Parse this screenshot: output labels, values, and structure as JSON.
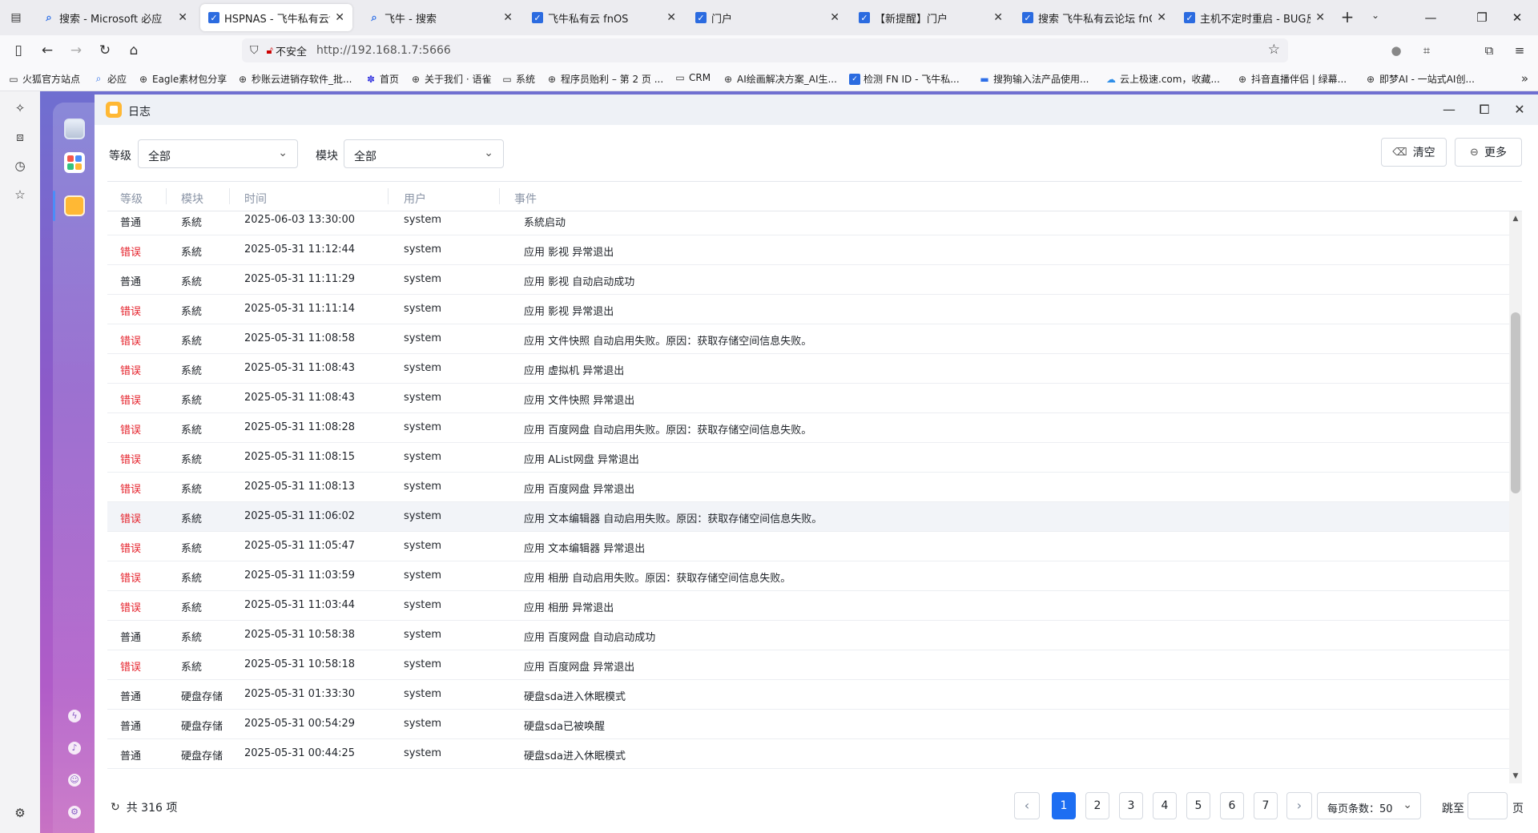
{
  "browser": {
    "tabs": [
      {
        "label": "搜索 - Microsoft 必应",
        "icon": "search-icon",
        "active": false
      },
      {
        "label": "HSPNAS - 飞牛私有云fnO",
        "icon": "fnos-icon",
        "active": true
      },
      {
        "label": "飞牛 - 搜索",
        "icon": "search-icon",
        "active": false
      },
      {
        "label": "飞牛私有云 fnOS",
        "icon": "fnos-icon",
        "active": false
      },
      {
        "label": "门户",
        "icon": "fnos-icon",
        "active": false
      },
      {
        "label": "【新提醒】门户",
        "icon": "fnos-icon",
        "active": false
      },
      {
        "label": "搜索 飞牛私有云论坛 fnOS",
        "icon": "fnos-icon",
        "active": false
      },
      {
        "label": "主机不定时重启 - BUG反馈",
        "icon": "fnos-icon",
        "active": false
      }
    ],
    "address": {
      "security_label": "不安全",
      "url": "http://192.168.1.7:5666"
    },
    "bookmarks": [
      {
        "label": "火狐官方站点",
        "icon": "folder-icon"
      },
      {
        "label": "必应",
        "icon": "search-icon"
      },
      {
        "label": "Eagle素材包分享",
        "icon": "globe-icon"
      },
      {
        "label": "秒账云进销存软件_批...",
        "icon": "globe-icon"
      },
      {
        "label": "首页",
        "icon": "paw-icon"
      },
      {
        "label": "关于我们 · 语雀",
        "icon": "globe-icon"
      },
      {
        "label": "系统",
        "icon": "folder-icon"
      },
      {
        "label": "程序员贻利 – 第 2 页 ...",
        "icon": "globe-icon"
      },
      {
        "label": "CRM",
        "icon": "folder-icon"
      },
      {
        "label": "AI绘画解决方案_AI生...",
        "icon": "globe-icon"
      },
      {
        "label": "检测 FN ID - 飞牛私...",
        "icon": "fnos-icon"
      },
      {
        "label": "搜狗输入法产品使用...",
        "icon": "doc-icon"
      },
      {
        "label": "云上极速.com，收藏...",
        "icon": "cloud-icon"
      },
      {
        "label": "抖音直播伴侣 | 绿幕...",
        "icon": "globe-icon"
      },
      {
        "label": "即梦AI - 一站式AI创...",
        "icon": "globe-icon"
      }
    ]
  },
  "logwin": {
    "title": "日志",
    "filters": {
      "level_label": "等级",
      "level_value": "全部",
      "module_label": "模块",
      "module_value": "全部"
    },
    "buttons": {
      "clear": "清空",
      "more": "更多"
    },
    "columns": [
      "等级",
      "模块",
      "时间",
      "用户",
      "事件"
    ],
    "rows": [
      {
        "level": "普通",
        "error": false,
        "module": "系統",
        "time": "2025-06-03 13:30:00",
        "user": "system",
        "event": "系統启动"
      },
      {
        "level": "错误",
        "error": true,
        "module": "系統",
        "time": "2025-05-31 11:12:44",
        "user": "system",
        "event": "应用 影视 异常退出"
      },
      {
        "level": "普通",
        "error": false,
        "module": "系統",
        "time": "2025-05-31 11:11:29",
        "user": "system",
        "event": "应用 影视 自动启动成功"
      },
      {
        "level": "错误",
        "error": true,
        "module": "系統",
        "time": "2025-05-31 11:11:14",
        "user": "system",
        "event": "应用 影视 异常退出"
      },
      {
        "level": "错误",
        "error": true,
        "module": "系統",
        "time": "2025-05-31 11:08:58",
        "user": "system",
        "event": "应用 文件快照 自动启用失败。原因：获取存储空间信息失败。"
      },
      {
        "level": "错误",
        "error": true,
        "module": "系統",
        "time": "2025-05-31 11:08:43",
        "user": "system",
        "event": "应用 虚拟机 异常退出"
      },
      {
        "level": "错误",
        "error": true,
        "module": "系統",
        "time": "2025-05-31 11:08:43",
        "user": "system",
        "event": "应用 文件快照 异常退出"
      },
      {
        "level": "错误",
        "error": true,
        "module": "系統",
        "time": "2025-05-31 11:08:28",
        "user": "system",
        "event": "应用 百度网盘 自动启用失败。原因：获取存储空间信息失败。"
      },
      {
        "level": "错误",
        "error": true,
        "module": "系統",
        "time": "2025-05-31 11:08:15",
        "user": "system",
        "event": "应用 AList网盘 异常退出"
      },
      {
        "level": "错误",
        "error": true,
        "module": "系統",
        "time": "2025-05-31 11:08:13",
        "user": "system",
        "event": "应用 百度网盘 异常退出"
      },
      {
        "level": "错误",
        "error": true,
        "module": "系統",
        "time": "2025-05-31 11:06:02",
        "user": "system",
        "event": "应用 文本编辑器 自动启用失败。原因：获取存储空间信息失败。"
      },
      {
        "level": "错误",
        "error": true,
        "module": "系統",
        "time": "2025-05-31 11:05:47",
        "user": "system",
        "event": "应用 文本编辑器 异常退出"
      },
      {
        "level": "错误",
        "error": true,
        "module": "系統",
        "time": "2025-05-31 11:03:59",
        "user": "system",
        "event": "应用 相册 自动启用失败。原因：获取存储空间信息失败。"
      },
      {
        "level": "错误",
        "error": true,
        "module": "系統",
        "time": "2025-05-31 11:03:44",
        "user": "system",
        "event": "应用 相册 异常退出"
      },
      {
        "level": "普通",
        "error": false,
        "module": "系統",
        "time": "2025-05-31 10:58:38",
        "user": "system",
        "event": "应用 百度网盘 自动启动成功"
      },
      {
        "level": "错误",
        "error": true,
        "module": "系統",
        "time": "2025-05-31 10:58:18",
        "user": "system",
        "event": "应用 百度网盘 异常退出"
      },
      {
        "level": "普通",
        "error": false,
        "module": "硬盘存储",
        "time": "2025-05-31 01:33:30",
        "user": "system",
        "event": "硬盘sda进入休眠模式"
      },
      {
        "level": "普通",
        "error": false,
        "module": "硬盘存储",
        "time": "2025-05-31 00:54:29",
        "user": "system",
        "event": "硬盘sda已被唤醒"
      },
      {
        "level": "普通",
        "error": false,
        "module": "硬盘存储",
        "time": "2025-05-31 00:44:25",
        "user": "system",
        "event": "硬盘sda进入休眠模式"
      }
    ],
    "footer": {
      "total": "共 316 项",
      "pages": [
        "1",
        "2",
        "3",
        "4",
        "5",
        "6",
        "7"
      ],
      "current_page": "1",
      "page_size": "每页条数：50",
      "jump_label": "跳至",
      "jump_suffix": "页",
      "jump_value": ""
    }
  },
  "colors": {
    "accent": "#1d6ef2",
    "error_text": "#e5202a",
    "header_text": "#8a94a6"
  }
}
